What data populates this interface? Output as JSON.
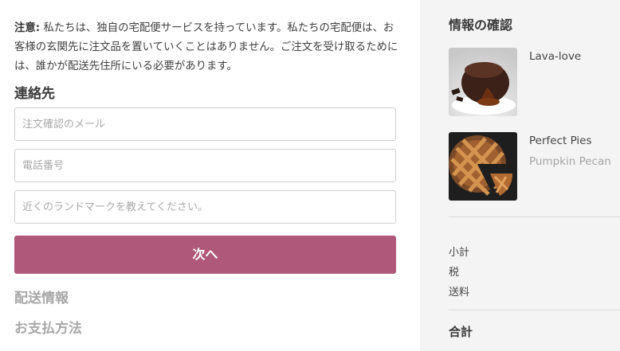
{
  "notice": {
    "label": "注意:",
    "text": " 私たちは、独自の宅配便サービスを持っています。私たちの宅配便は、お客様の玄関先に注文品を置いていくことはありません。ご注文を受け取るためには、誰かが配送先住所にいる必要があります。"
  },
  "contact": {
    "title": "連絡先",
    "email_placeholder": "注文確認のメール",
    "phone_placeholder": "電話番号",
    "landmark_placeholder": "近くのランドマークを教えてください。",
    "next_label": "次へ"
  },
  "steps": {
    "shipping": "配送情報",
    "payment": "お支払方法"
  },
  "review": {
    "title": "情報の確認",
    "items": [
      {
        "name": "Lava-love",
        "variant": ""
      },
      {
        "name": "Perfect Pies",
        "variant": "Pumpkin Pecan"
      }
    ],
    "subtotal_label": "小計",
    "tax_label": "税",
    "shipping_label": "送料",
    "total_label": "合計"
  },
  "colors": {
    "accent": "#b0587a",
    "sidebar_bg": "#f4f4f4"
  }
}
